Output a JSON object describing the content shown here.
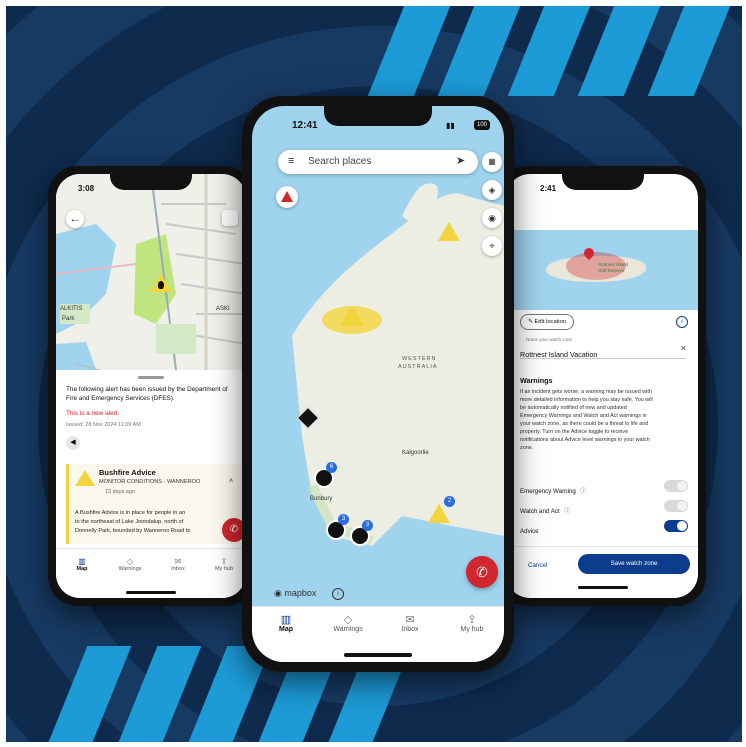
{
  "left_phone": {
    "time": "3:08",
    "alert_intro": "The following alert has been issued by the Department of Fire and Emergency Services (DFES).",
    "new_alert": "This is a new alert.",
    "issued": "Issued: 28 Nov 2024 11:09 AM",
    "advice_title": "Bushfire Advice",
    "advice_sub": "MONITOR CONDITIONS - WANNEROO",
    "advice_time": "13 days ago",
    "advice_body_1": "A Bushfire Advice is in place for people in an",
    "advice_body_2": "to the northeast of Lake Joondalup, north of",
    "advice_body_3": "Donnelly Park, bounded by Wanneroo Road to",
    "map_label_1": "ALKITIS",
    "map_label_2": "Park",
    "map_label_3": "ASKI",
    "nav": [
      "Map",
      "Warnings",
      "Inbox",
      "My hub"
    ]
  },
  "center_phone": {
    "time": "12:41",
    "battery": "100",
    "search_placeholder": "Search places",
    "state_label_1": "WESTERN",
    "state_label_2": "AUSTRALIA",
    "city_kalgoorlie": "Kalgoorlie",
    "city_bunbury": "Bunbury",
    "badges": [
      "6",
      "3",
      "3",
      "2"
    ],
    "mapbox": "mapbox",
    "nav": [
      "Map",
      "Warnings",
      "Inbox",
      "My hub"
    ]
  },
  "right_phone": {
    "time": "2:41",
    "island_label_1": "Rottnest Island",
    "island_label_2": "Golf Reserve",
    "edit_location": "Edit location",
    "name_hint": "Name your watch zone",
    "zone_name": "Rottnest Island Vacation",
    "warnings_heading": "Warnings",
    "warnings_body": [
      "If an incident gets worse, a warning may be issued with",
      "more detailed information to help you stay safe. You will",
      "be automatically notified of new and updated",
      "Emergency Warnings and Watch and Act warnings in",
      "your watch zone, as there could be a threat to life and",
      "property. Turn on the Advice toggle to receive",
      "notifications about Advice level warnings in your watch",
      "zone."
    ],
    "toggles": [
      "Emergency Warning",
      "Watch and Act",
      "Advice"
    ],
    "cancel": "Cancel",
    "save": "Save watch zone"
  },
  "colors": {
    "navy": "#173a63",
    "stripe_blue": "#1d9bd7",
    "fire_red": "#d0262e",
    "warning_yellow": "#f2d43c",
    "map_water": "#9fd3ee",
    "app_navy": "#0b3d8c"
  }
}
